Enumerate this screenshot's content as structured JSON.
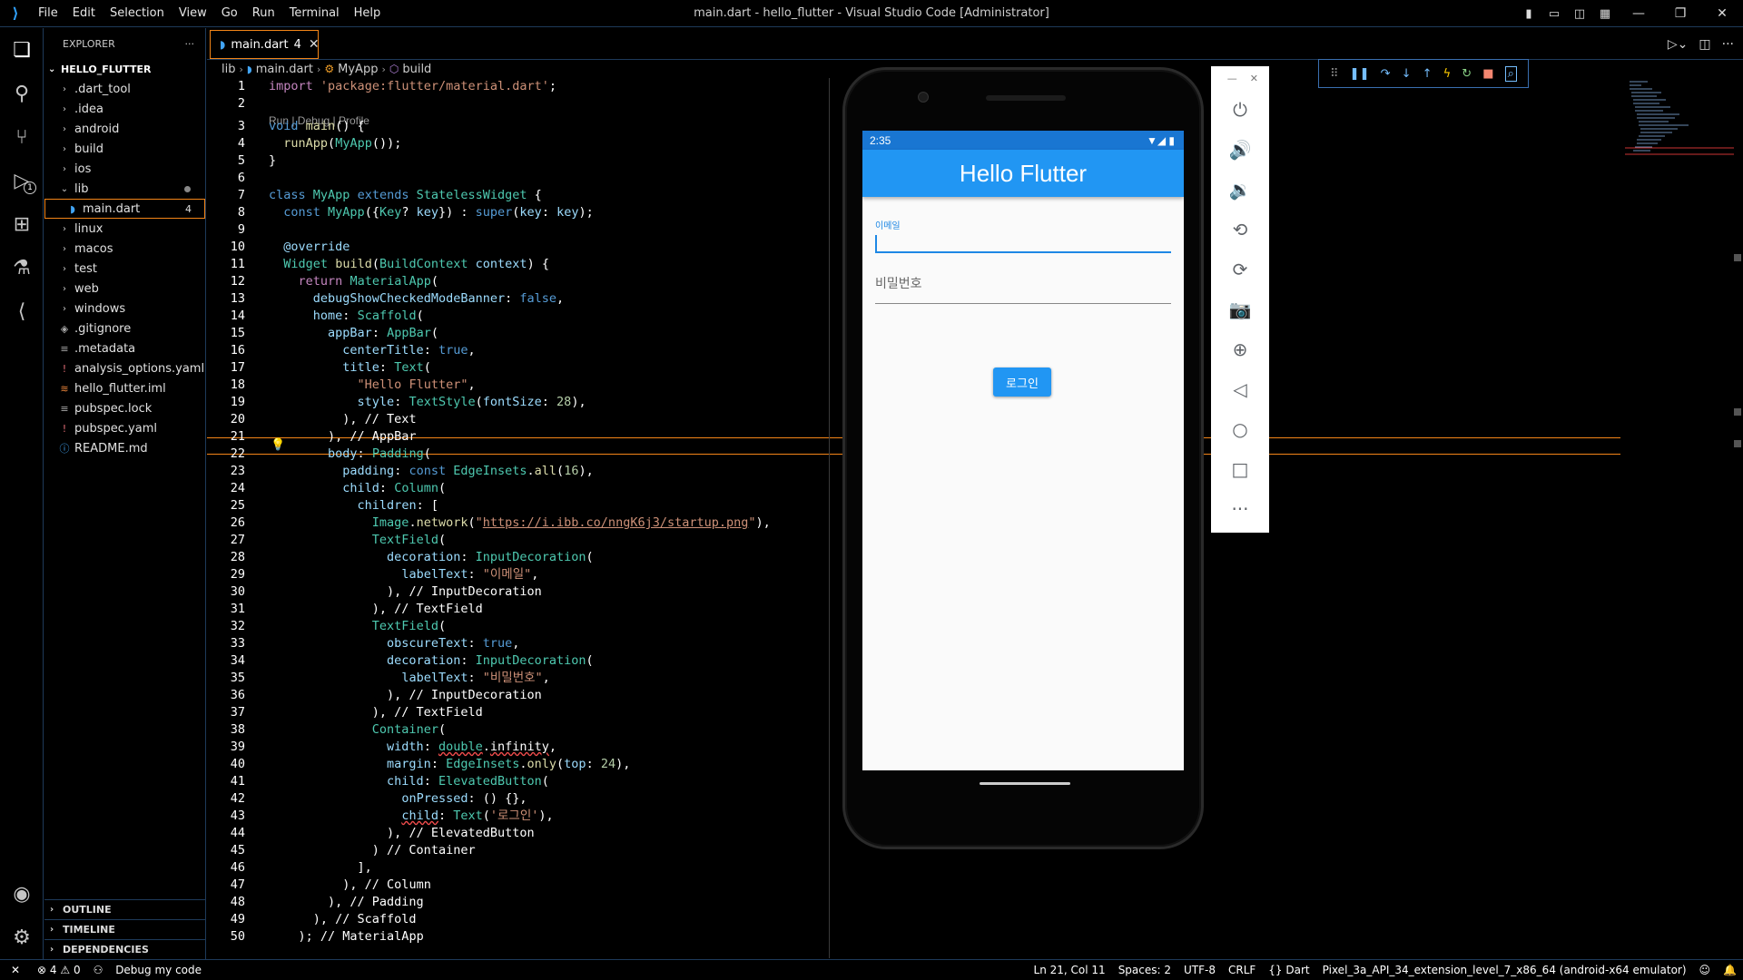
{
  "window": {
    "title": "main.dart - hello_flutter - Visual Studio Code [Administrator]",
    "menu": [
      "File",
      "Edit",
      "Selection",
      "View",
      "Go",
      "Run",
      "Terminal",
      "Help"
    ]
  },
  "sidebar": {
    "header": "EXPLORER",
    "folder": "HELLO_FLUTTER",
    "items": [
      {
        "label": ".dart_tool",
        "type": "folder"
      },
      {
        "label": ".idea",
        "type": "folder"
      },
      {
        "label": "android",
        "type": "folder"
      },
      {
        "label": "build",
        "type": "folder"
      },
      {
        "label": "ios",
        "type": "folder"
      },
      {
        "label": "lib",
        "type": "folder-open"
      },
      {
        "label": "main.dart",
        "type": "file",
        "count": "4"
      },
      {
        "label": "linux",
        "type": "folder"
      },
      {
        "label": "macos",
        "type": "folder"
      },
      {
        "label": "test",
        "type": "folder"
      },
      {
        "label": "web",
        "type": "folder"
      },
      {
        "label": "windows",
        "type": "folder"
      },
      {
        "label": ".gitignore",
        "type": "file"
      },
      {
        "label": ".metadata",
        "type": "file"
      },
      {
        "label": "analysis_options.yaml",
        "type": "file"
      },
      {
        "label": "hello_flutter.iml",
        "type": "file"
      },
      {
        "label": "pubspec.lock",
        "type": "file"
      },
      {
        "label": "pubspec.yaml",
        "type": "file"
      },
      {
        "label": "README.md",
        "type": "file"
      }
    ],
    "sections": [
      "OUTLINE",
      "TIMELINE",
      "DEPENDENCIES"
    ]
  },
  "tab": {
    "label": "main.dart",
    "count": "4"
  },
  "breadcrumb": [
    "lib",
    "main.dart",
    "MyApp",
    "build"
  ],
  "codelens": "Run | Debug | Profile",
  "emulator": {
    "time": "2:35",
    "app_title": "Hello Flutter",
    "email_label": "이메일",
    "password_label": "비밀번호",
    "login_button": "로그인"
  },
  "statusbar": {
    "errors": "4",
    "warnings": "0",
    "debug": "Debug my code",
    "position": "Ln 21, Col 11",
    "spaces": "Spaces: 2",
    "encoding": "UTF-8",
    "eol": "CRLF",
    "language": "Dart",
    "device": "Pixel_3a_API_34_extension_level_7_x86_64 (android-x64 emulator)"
  },
  "colors": {
    "accent": "#f38518",
    "appbar": "#2196f3",
    "border": "#1e3a5a"
  }
}
